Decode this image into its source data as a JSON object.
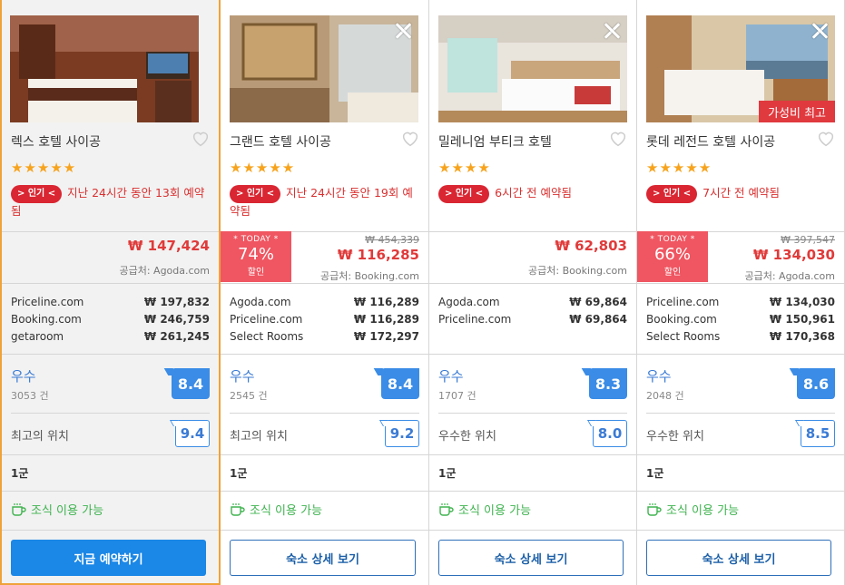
{
  "colors": {
    "accent_blue": "#1b87e6",
    "score_blue": "#3a8ce6",
    "price_red": "#e03a3a",
    "highlight_border": "#f0a23a",
    "breakfast_green": "#3fb34f",
    "today_badge": "#ef5661"
  },
  "hotels": [
    {
      "name": "렉스 호텔 사이공",
      "stars": "★★★★★",
      "popular_badge": "> 인기 <",
      "popular_text": "지난 24시간 동안 13회 예약됨",
      "price": "₩ 147,424",
      "supplier": "공급처: Agoda.com",
      "vendors": [
        {
          "name": "Priceline.com",
          "price": "₩ 197,832"
        },
        {
          "name": "Booking.com",
          "price": "₩ 246,759"
        },
        {
          "name": "getaroom",
          "price": "₩ 261,245"
        }
      ],
      "rating_word": "우수",
      "review_count": "3053 건",
      "score": "8.4",
      "location_text": "최고의 위치",
      "location_score": "9.4",
      "district": "1군",
      "breakfast": "조식 이용 가능",
      "button": "지금 예약하기",
      "icon": "heart-icon"
    },
    {
      "name": "그랜드 호텔 사이공",
      "stars": "★★★★★",
      "popular_badge": "> 인기 <",
      "popular_text": "지난 24시간 동안 19회 예약됨",
      "today_label": "* TODAY *",
      "discount": "74%",
      "discount_label": "할인",
      "old_price": "₩ 454,339",
      "price": "₩ 116,285",
      "supplier": "공급처: Booking.com",
      "vendors": [
        {
          "name": "Agoda.com",
          "price": "₩ 116,289"
        },
        {
          "name": "Priceline.com",
          "price": "₩ 116,289"
        },
        {
          "name": "Select Rooms",
          "price": "₩ 172,297"
        }
      ],
      "rating_word": "우수",
      "review_count": "2545 건",
      "score": "8.4",
      "location_text": "최고의 위치",
      "location_score": "9.2",
      "district": "1군",
      "breakfast": "조식 이용 가능",
      "button": "숙소 상세 보기"
    },
    {
      "name": "밀레니엄 부티크 호텔",
      "stars": "★★★★",
      "popular_badge": "> 인기 <",
      "popular_text": "6시간 전 예약됨",
      "price": "₩ 62,803",
      "supplier": "공급처: Booking.com",
      "vendors": [
        {
          "name": "Agoda.com",
          "price": "₩ 69,864"
        },
        {
          "name": "Priceline.com",
          "price": "₩ 69,864"
        }
      ],
      "rating_word": "우수",
      "review_count": "1707 건",
      "score": "8.3",
      "location_text": "우수한 위치",
      "location_score": "8.0",
      "district": "1군",
      "breakfast": "조식 이용 가능",
      "button": "숙소 상세 보기"
    },
    {
      "name": "롯데 레전드 호텔 사이공",
      "stars": "★★★★★",
      "value_badge": "가성비 최고",
      "popular_badge": "> 인기 <",
      "popular_text": "7시간 전 예약됨",
      "today_label": "* TODAY *",
      "discount": "66%",
      "discount_label": "할인",
      "old_price": "₩ 397,547",
      "price": "₩ 134,030",
      "supplier": "공급처: Agoda.com",
      "vendors": [
        {
          "name": "Priceline.com",
          "price": "₩ 134,030"
        },
        {
          "name": "Booking.com",
          "price": "₩ 150,961"
        },
        {
          "name": "Select Rooms",
          "price": "₩ 170,368"
        }
      ],
      "rating_word": "우수",
      "review_count": "2048 건",
      "score": "8.6",
      "location_text": "우수한 위치",
      "location_score": "8.5",
      "district": "1군",
      "breakfast": "조식 이용 가능",
      "button": "숙소 상세 보기"
    }
  ]
}
